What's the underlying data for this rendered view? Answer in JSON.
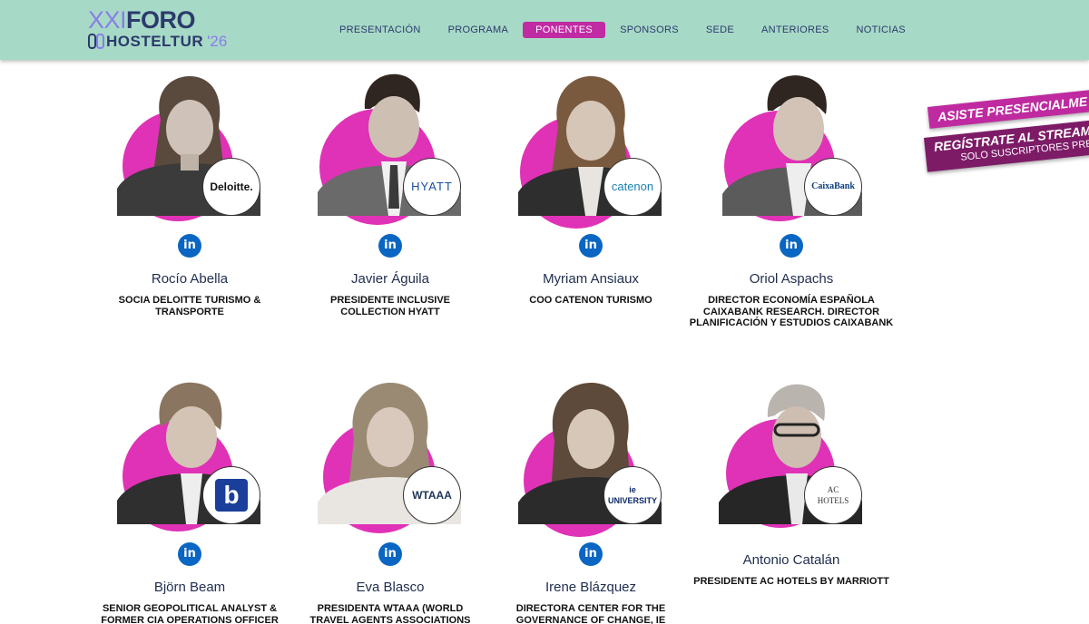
{
  "header": {
    "logo": {
      "line1_a": "XXI",
      "line1_b": "FORO",
      "line2_a": "HOSTELTUR",
      "line2_b": "'26"
    },
    "nav": [
      {
        "label": "PRESENTACIÓN"
      },
      {
        "label": "PROGRAMA"
      },
      {
        "label": "PONENTES",
        "active": true
      },
      {
        "label": "SPONSORS"
      },
      {
        "label": "SEDE"
      },
      {
        "label": "ANTERIORES"
      },
      {
        "label": "NOTICIAS"
      }
    ]
  },
  "banners": {
    "attend": "ASISTE PRESENCIALME",
    "stream": "REGÍSTRATE AL STREAM",
    "stream_sub": "SOLO SUSCRIPTORES PRE"
  },
  "colors": {
    "header_bg": "#a7d9c7",
    "accent": "#c02aa3",
    "blob": "#e032b6",
    "linkedin": "#0a66c2",
    "text": "#1f2d4e"
  },
  "speakers": [
    {
      "name": "Rocío Abella",
      "role": "SOCIA DELOITTE TURISMO & TRANSPORTE",
      "company": "Deloitte.",
      "linkedin": "in"
    },
    {
      "name": "Javier Águila",
      "role": "PRESIDENTE INCLUSIVE COLLECTION HYATT",
      "company": "HYATT",
      "linkedin": "in"
    },
    {
      "name": "Myriam Ansiaux",
      "role": "COO CATENON TURISMO",
      "company": "catenon",
      "linkedin": "in"
    },
    {
      "name": "Oriol Aspachs",
      "role": "DIRECTOR ECONOMÍA ESPAÑOLA CAIXABANK RESEARCH. DIRECTOR PLANIFICACIÓN Y ESTUDIOS CAIXABANK",
      "company": "CaixaBank",
      "linkedin": "in"
    },
    {
      "name": "Björn Beam",
      "role": "SENIOR GEOPOLITICAL ANALYST & FORMER CIA OPERATIONS OFFICER -",
      "company": "b",
      "linkedin": "in"
    },
    {
      "name": "Eva Blasco",
      "role": "PRESIDENTA WTAAA (WORLD TRAVEL AGENTS ASSOCIATIONS ALLIANCE)",
      "company": "WTAAA",
      "linkedin": "in"
    },
    {
      "name": "Irene Blázquez",
      "role": "DIRECTORA CENTER FOR THE GOVERNANCE OF CHANGE, IE",
      "company": "ie UNIVERSITY",
      "linkedin": "in"
    },
    {
      "name": "Antonio Catalán",
      "role": "PRESIDENTE AC HOTELS BY MARRIOTT",
      "company": "AC HOTELS",
      "linkedin": ""
    }
  ]
}
